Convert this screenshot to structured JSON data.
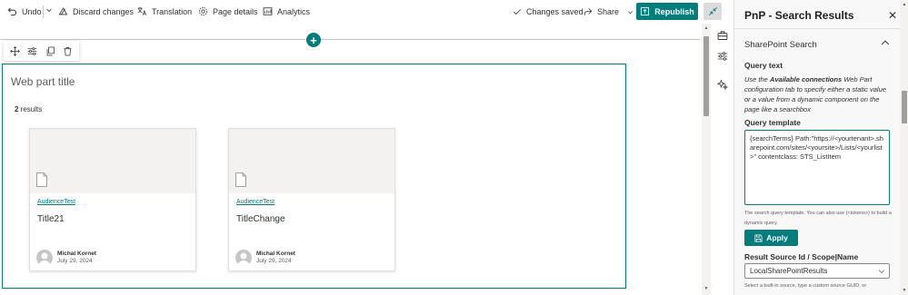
{
  "command_bar": {
    "undo_label": "Undo",
    "discard_label": "Discard changes",
    "translation_label": "Translation",
    "page_details_label": "Page details",
    "analytics_label": "Analytics",
    "status_label": "Changes saved",
    "share_label": "Share",
    "republish_label": "Republish"
  },
  "webpart": {
    "title_placeholder": "Web part title",
    "results_count": "2",
    "results_suffix": " results",
    "cards": [
      {
        "tag": "AudienceTest",
        "title": "Title21",
        "author": "Michal Kornet",
        "date": "July 29, 2024"
      },
      {
        "tag": "AudienceTest",
        "title": "TitleChange",
        "author": "Michal Kornet",
        "date": "July 29, 2024"
      }
    ]
  },
  "property_pane": {
    "title": "PnP - Search Results",
    "close_glyph": "✕",
    "group_title": "SharePoint Search",
    "query_text_label": "Query text",
    "query_text_desc_prefix": "Use the ",
    "query_text_desc_bold": "Available connections",
    "query_text_desc_suffix": " Web Part configuration tab to specify either a static value or a value from a dynamic component on the page like a searchbox",
    "query_template_label": "Query template",
    "query_template_value": "{searchTerms} Path:\"https://<yourtenant>.sharepoint.com/sites/<yoursite>/Lists/<yourlist>\" contentclass: STS_ListItem",
    "query_template_help": "The search query template. You can also use {<tokens>} to build a dynamic query.",
    "apply_label": "Apply",
    "result_source_label": "Result Source Id / Scope|Name",
    "result_source_value": "LocalSharePointResults",
    "result_source_help": "Select a built-in source, type a custom source GUID, or"
  },
  "colors": {
    "accent": "#037c7c",
    "text": "#323130",
    "pane_bg": "#f8f8f8"
  },
  "icons": [
    "undo-icon",
    "chevron-down-icon",
    "discard-icon",
    "translation-icon",
    "settings-icon",
    "analytics-icon",
    "check-icon",
    "share-icon",
    "republish-icon",
    "collapse-icon",
    "move-icon",
    "edit-props-icon",
    "duplicate-icon",
    "delete-icon",
    "document-icon",
    "toolbox-icon",
    "page-settings-icon",
    "design-ideas-icon",
    "save-icon"
  ]
}
